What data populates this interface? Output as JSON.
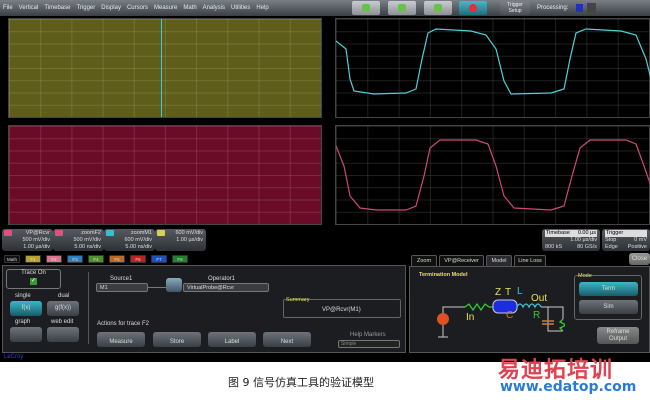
{
  "menu": [
    "File",
    "Vertical",
    "Timebase",
    "Trigger",
    "Display",
    "Cursors",
    "Measure",
    "Math",
    "Analysis",
    "Utilities",
    "Help"
  ],
  "toolbar": {
    "trigger_setup": "Trigger\nSetup",
    "processing": "Processing:"
  },
  "traces": [
    {
      "name": "VP@Rcvr",
      "tag": "F2",
      "vdiv": "500 mV/div",
      "tdiv": "1.00 µs/div",
      "color": "#e0507a"
    },
    {
      "name": "zoomF2",
      "tag": "Z2",
      "vdiv": "500 mV/div",
      "tdiv": "5.00 ns/div",
      "color": "#e0507a"
    },
    {
      "name": "zoomM1",
      "tag": "Z1",
      "vdiv": "600 mV/div",
      "tdiv": "5.00 ns/div",
      "color": "#35c0d0"
    },
    {
      "name": "",
      "tag": "M1",
      "vdiv": "600 mV/div",
      "tdiv": "1.00 µs/div",
      "color": "#d8d050"
    }
  ],
  "timebase": {
    "label": "Timebase",
    "delay": "0.00 µs",
    "tdiv": "1.00 µs/div",
    "samples": "800 kS",
    "rate": "80 GS/s"
  },
  "trigger": {
    "label": "Trigger",
    "mode": "Stop",
    "type": "Edge",
    "level": "0 mV",
    "slope": "Positive"
  },
  "fn_tabs": [
    "Math",
    "F1",
    "F2",
    "F3",
    "F4",
    "F5",
    "F6",
    "F7",
    "F8"
  ],
  "left": {
    "trace_on": "Trace On",
    "single": "single",
    "dual": "dual",
    "fx": "f(x)",
    "gfx": "g(f(x))",
    "graph": "graph",
    "web_edit": "web edit",
    "source_label": "Source1",
    "source": "M1",
    "operator_label": "Operator1",
    "operator": "VirtualProbe@Rcvr",
    "summary_label": "Summary",
    "summary": "VP@Rcvr(M1)",
    "actions_label": "Actions for trace F2",
    "actions": [
      "Measure",
      "Store",
      "Label",
      "Next"
    ],
    "help_label": "Help Markers",
    "help_value": "Simple"
  },
  "right": {
    "tabs": [
      "Zoom",
      "VP@Receiver",
      "Model",
      "Line Loss"
    ],
    "close": "Close",
    "model_title": "Termination Model",
    "mode_label": "Mode",
    "modes": [
      "Term",
      "Sim"
    ],
    "reframe": "Reframe\nOutput",
    "schematic": {
      "z": "Z",
      "t": "T",
      "l": "L",
      "c": "C",
      "r": "R",
      "in": "In",
      "out": "Out"
    }
  },
  "brand": "LeCroy",
  "caption": "图 9  信号仿真工具的验证模型",
  "watermark": {
    "cn": "易迪拓培训",
    "url": "www.edatop.com"
  }
}
